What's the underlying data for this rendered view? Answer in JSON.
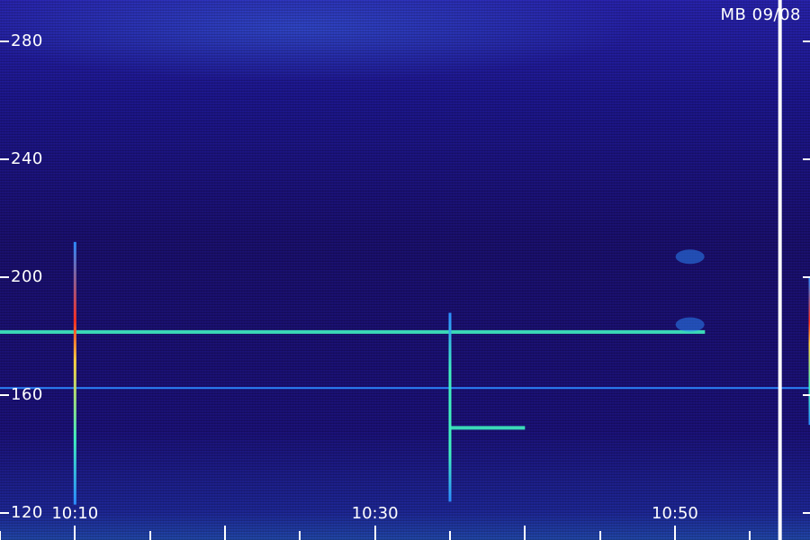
{
  "chart_data": {
    "type": "heatmap",
    "title": "",
    "stamp": "MB 09/08",
    "xlabel": "",
    "ylabel": "",
    "y_ticks": [
      {
        "value": 280,
        "label": "280"
      },
      {
        "value": 240,
        "label": "240"
      },
      {
        "value": 200,
        "label": "200"
      },
      {
        "value": 160,
        "label": "160"
      },
      {
        "value": 120,
        "label": "120"
      }
    ],
    "x_ticks": [
      {
        "value": "10:10",
        "label": "10:10"
      },
      {
        "value": "10:30",
        "label": "10:30"
      },
      {
        "value": "10:50",
        "label": "10:50"
      }
    ],
    "x_minor_ticks": [
      "10:05",
      "10:10",
      "10:15",
      "10:20",
      "10:25",
      "10:30",
      "10:35",
      "10:40",
      "10:45",
      "10:50",
      "10:55"
    ],
    "ylim": [
      111,
      294
    ],
    "xlim": [
      "10:05",
      "10:59"
    ],
    "grid": false,
    "colors": {
      "background": "#1a0f6e",
      "noise_low": "#150b70",
      "noise_high": "#3a2ef0",
      "signal_mid": "#2c8cff",
      "signal_high": "#3ff0c0",
      "signal_peak": "#ffd040",
      "signal_max": "#ff3020",
      "tick": "#ffffff"
    },
    "features": [
      {
        "kind": "hline",
        "y": 181.5,
        "x_start": "10:05",
        "x_end": "10:52",
        "intensity": "high"
      },
      {
        "kind": "hline",
        "y": 149,
        "x_start": "10:35",
        "x_end": "10:40",
        "intensity": "high"
      },
      {
        "kind": "hline",
        "y": 162.5,
        "x_start": "10:05",
        "x_end": "10:59",
        "intensity": "mid"
      },
      {
        "kind": "vline",
        "x": "10:10",
        "y_start": 123,
        "y_end": 212,
        "intensity": "peak"
      },
      {
        "kind": "vline",
        "x": "10:35",
        "y_start": 124,
        "y_end": 188,
        "intensity": "high"
      },
      {
        "kind": "vline",
        "x": "10:57",
        "y_start": 140,
        "y_end": 208,
        "intensity": "peak"
      },
      {
        "kind": "vline",
        "x": "10:59",
        "y_start": 150,
        "y_end": 200,
        "intensity": "peak"
      },
      {
        "kind": "blob",
        "x": "10:51",
        "y": 207,
        "intensity": "mid"
      },
      {
        "kind": "blob",
        "x": "10:51",
        "y": 184,
        "intensity": "mid"
      }
    ],
    "white_markers": [
      "10:57"
    ]
  }
}
